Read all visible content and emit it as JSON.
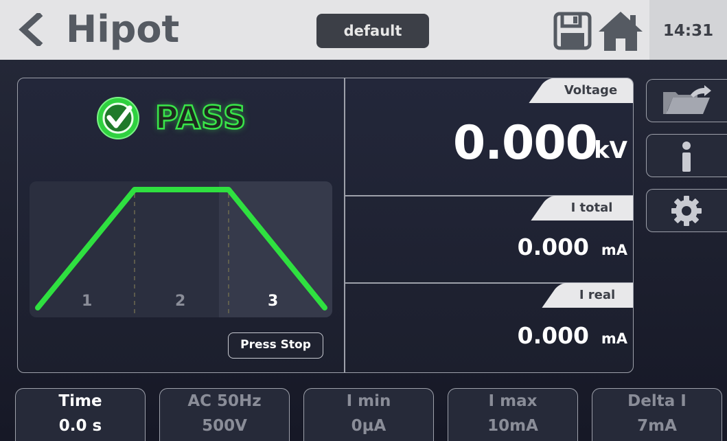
{
  "header": {
    "back_label": "Hipot",
    "profile_name": "default",
    "clock": "14:31"
  },
  "status": {
    "result": "PASS",
    "result_color": "#39e649"
  },
  "test_profile": {
    "steps": [
      "1",
      "2",
      "3"
    ],
    "active_step": 3,
    "press_stop_label": "Press Stop"
  },
  "measurements": {
    "voltage": {
      "label": "Voltage",
      "value": "0.000",
      "unit": "kV"
    },
    "i_total": {
      "label": "I total",
      "value": "0.000",
      "unit": "mA"
    },
    "i_real": {
      "label": "I real",
      "value": "0.000",
      "unit": "mA"
    }
  },
  "side_buttons": [
    "folder-export-icon",
    "info-icon",
    "gear-icon"
  ],
  "parameters": [
    {
      "label": "Time",
      "value": "0.0 s"
    },
    {
      "label": "AC 50Hz",
      "value": "500V"
    },
    {
      "label": "I min",
      "value": "0µA"
    },
    {
      "label": "I max",
      "value": "10mA"
    },
    {
      "label": "Delta I",
      "value": "7mA"
    }
  ]
}
